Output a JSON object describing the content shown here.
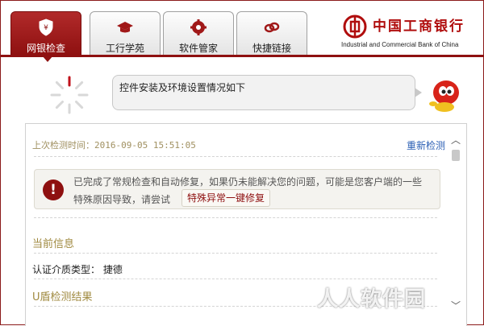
{
  "tabs": [
    {
      "label": "网银检查",
      "icon": "shield-icon"
    },
    {
      "label": "工行学苑",
      "icon": "graduation-cap-icon"
    },
    {
      "label": "软件管家",
      "icon": "gear-icon"
    },
    {
      "label": "快捷链接",
      "icon": "link-icon"
    }
  ],
  "brand": {
    "name_cn": "中国工商银行",
    "name_en": "Industrial and Commercial Bank of China",
    "color": "#b00d0d"
  },
  "status": {
    "message": "控件安装及环境设置情况如下"
  },
  "panel": {
    "last_check": "上次检测时间：2016-09-05 15:51:05",
    "recheck_label": "重新检测",
    "notice_line1": "已完成了常规检查和自动修复，如果仍未能解决您的问题，可能是您客户端的一些",
    "notice_line2": "特殊原因导致，请尝试",
    "fix_button": "特殊异常一键修复",
    "current_info_title": "当前信息",
    "auth_type": "认证介质类型：  捷德",
    "ukey_title": "U盾检测结果"
  },
  "watermark": "人人软件园",
  "colors": {
    "accent": "#8e1010",
    "link": "#2b5fb4",
    "section_title": "#a08a40"
  }
}
